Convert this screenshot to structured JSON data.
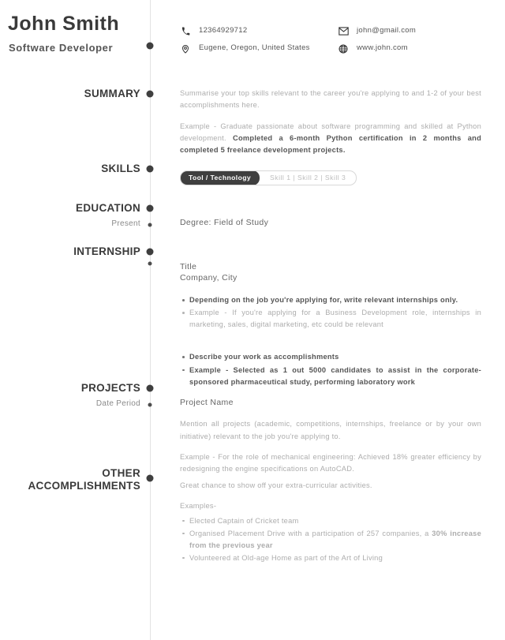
{
  "header": {
    "name": "John Smith",
    "role": "Software Developer",
    "contacts": {
      "phone": "12364929712",
      "location": "Eugene, Oregon, United States",
      "email": "john@gmail.com",
      "website": "www.john.com"
    }
  },
  "sections": {
    "summary": {
      "title": "SUMMARY",
      "para1": "Summarise your top skills relevant to the career you're applying to and 1-2 of your best accomplishments here.",
      "para2_light": "Example - Graduate passionate about software programming and skilled at Python development. ",
      "para2_bold": "Completed a 6-month Python certification in 2 months and completed 5 freelance development projects."
    },
    "skills": {
      "title": "SKILLS",
      "pill_key": "Tool / Technology",
      "pill_values": "Skill  1   |   Skill  2   |   Skill  3"
    },
    "education": {
      "title": "EDUCATION",
      "date": "Present",
      "degree": "Degree: Field of Study"
    },
    "internship": {
      "title": "INTERNSHIP",
      "entry_title": "Title",
      "entry_company": "Company, City",
      "bullets_group1": [
        {
          "text": "Depending on the job you're applying for, write relevant internships only.",
          "bold": true
        },
        {
          "text": "Example - If you're applying for a Business Development role, internships in marketing, sales, digital marketing, etc could be relevant",
          "bold": false
        }
      ],
      "bullets_group2": [
        {
          "text": "Describe your work as accomplishments",
          "bold": true
        },
        {
          "text": "Example - Selected as 1 out 5000 candidates to assist in the corporate-sponsored pharmaceutical study, performing laboratory work",
          "bold": true
        }
      ]
    },
    "projects": {
      "title": "PROJECTS",
      "date": "Date Period",
      "project_name": "Project Name",
      "para1": "Mention all projects (academic, competitions, internships, freelance or by your own initiative) relevant to the job you're applying to.",
      "para2": "Example - For the role of mechanical engineering: Achieved 18% greater efficiency by redesigning the engine specifications on AutoCAD."
    },
    "other": {
      "title_line1": "OTHER",
      "title_line2": "ACCOMPLISHMENTS",
      "para1": "Great chance to show off your extra-curricular activities.",
      "examples_label": "Examples-",
      "bullets": [
        {
          "light": "Elected Captain of Cricket team",
          "bold": ""
        },
        {
          "light": "Organised Placement Drive with a participation of 257 companies, a ",
          "bold": "30% increase from the previous year"
        },
        {
          "light": "Volunteered at Old-age Home as part of the Art of Living",
          "bold": ""
        }
      ]
    }
  },
  "icons": {
    "phone": "phone-icon",
    "location": "location-pin-icon",
    "email": "envelope-icon",
    "website": "globe-icon"
  }
}
